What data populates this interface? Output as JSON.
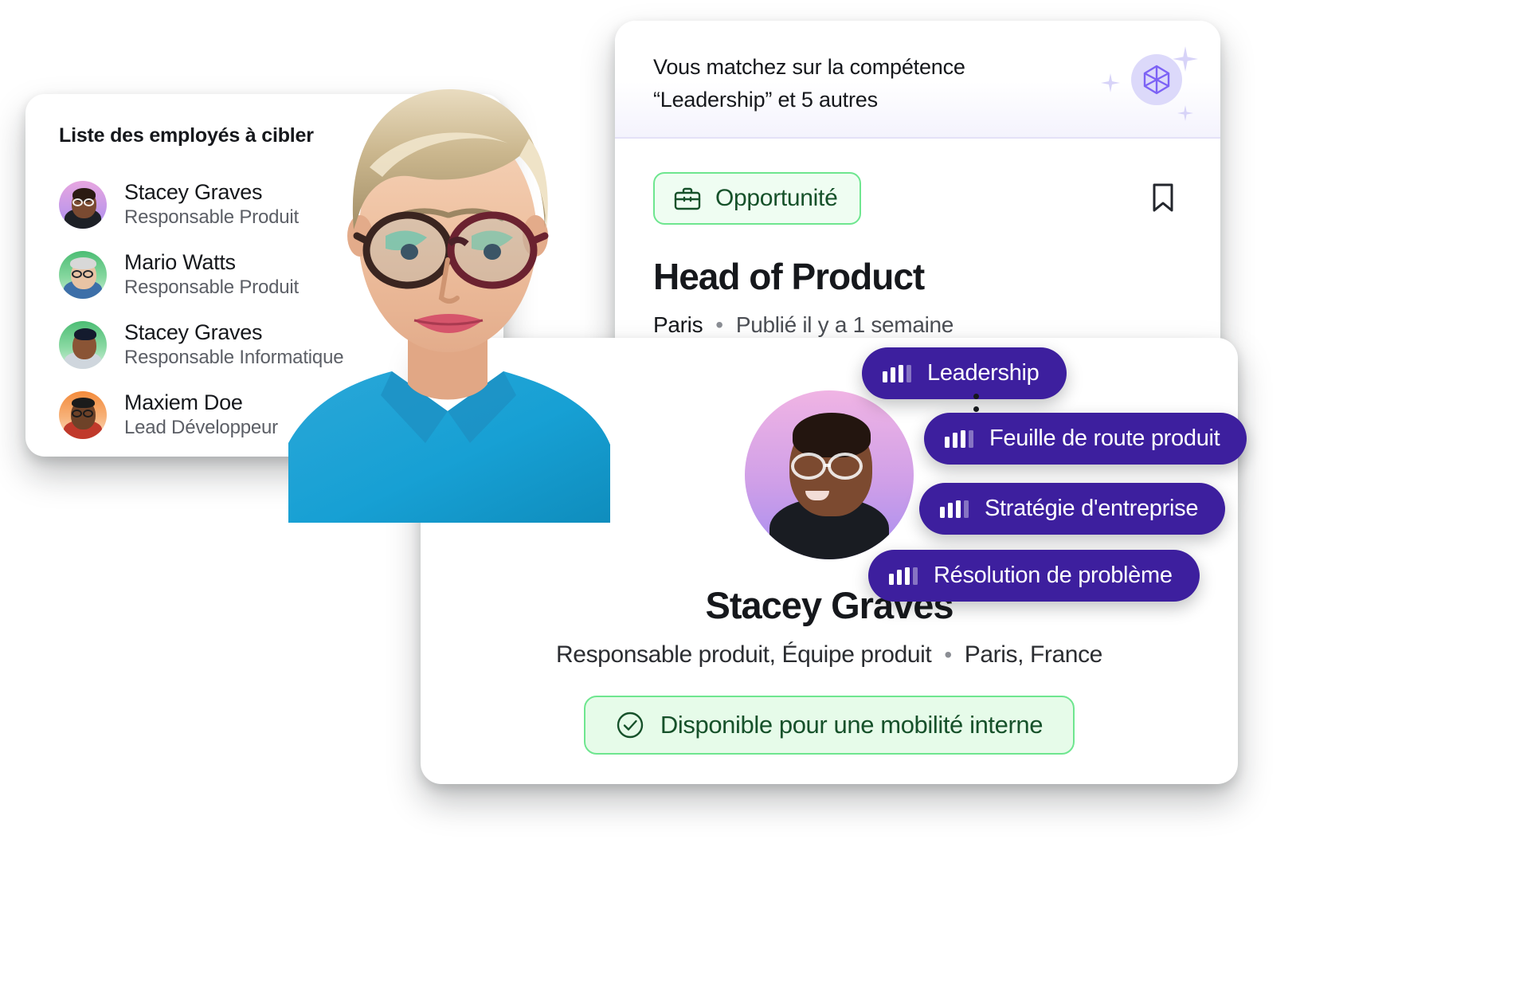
{
  "employee_list": {
    "title": "Liste des employés à cibler",
    "items": [
      {
        "name": "Stacey Graves",
        "role": "Responsable Produit",
        "avatar": "avatar-stacey-graves-purple"
      },
      {
        "name": "Mario Watts",
        "role": "Responsable Produit",
        "avatar": "avatar-mario-watts-green"
      },
      {
        "name": "Stacey Graves",
        "role": "Responsable Informatique",
        "avatar": "avatar-stacey-graves-green"
      },
      {
        "name": "Maxiem Doe",
        "role": "Lead Développeur",
        "avatar": "avatar-maxiem-doe-orange"
      }
    ]
  },
  "job_card": {
    "banner_line1": "Vous matchez sur la compétence",
    "banner_line2": "“Leadership” et 5 autres",
    "ai_icon": "ai-gem-icon",
    "sparkle_icon": "sparkle-icon",
    "opportunity_label": "Opportunité",
    "opportunity_icon": "briefcase-icon",
    "bookmark_icon": "bookmark-icon",
    "title": "Head of Product",
    "location": "Paris",
    "separator": "•",
    "published": "Publié il y a 1 semaine"
  },
  "skills": [
    {
      "label": "Leadership",
      "icon": "skill-level-icon",
      "level": 3,
      "max": 4
    },
    {
      "label": "Feuille de route produit",
      "icon": "skill-level-icon",
      "level": 3,
      "max": 4
    },
    {
      "label": "Stratégie d'entreprise",
      "icon": "skill-level-icon",
      "level": 3,
      "max": 4
    },
    {
      "label": "Résolution de problème",
      "icon": "skill-level-icon",
      "level": 3,
      "max": 4
    }
  ],
  "profile_card": {
    "avatar": "avatar-stacey-graves-large",
    "name": "Stacey Graves",
    "role": "Responsable produit, Équipe produit",
    "separator": "•",
    "location": "Paris, France",
    "availability_label": "Disponible pour une mobilité interne",
    "availability_icon": "check-circle-icon"
  },
  "hero_photo": {
    "alt": "photo-femme-lunettes-chemise-bleue"
  },
  "colors": {
    "pill_purple": "#3d1f9e",
    "green_accent": "#6ee68f",
    "green_text": "#16512a",
    "green_bg_light": "#effdf2",
    "ai_lavender": "#dcd9fa",
    "ai_purple": "#7c62f5",
    "text_primary": "#16181c",
    "text_secondary": "#5c5f66"
  }
}
